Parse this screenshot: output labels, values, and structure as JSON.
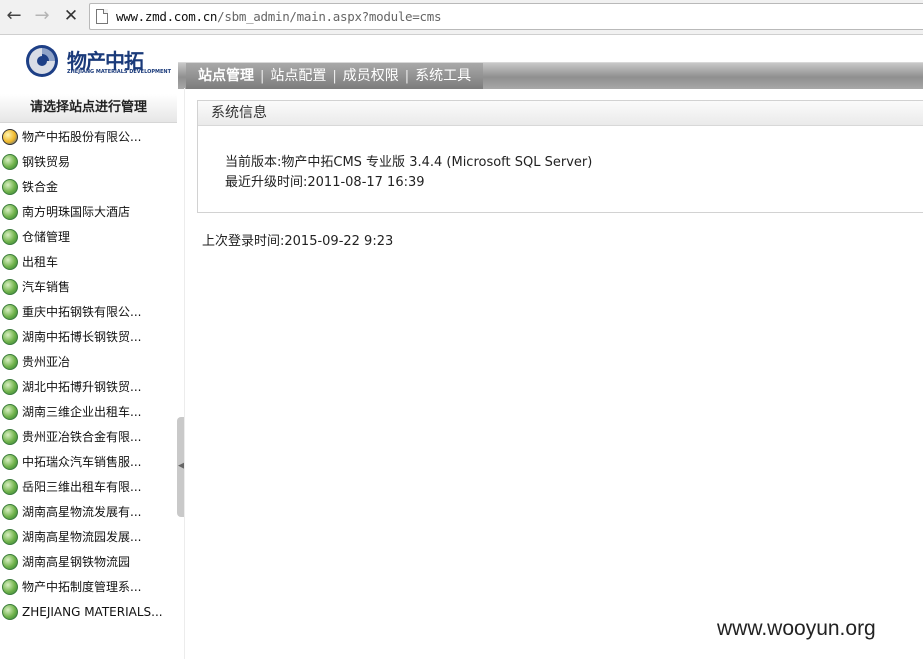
{
  "browser": {
    "url_host": "www.zmd.com.cn",
    "url_path": "/sbm_admin/main.aspx?module=cms"
  },
  "logo": {
    "cn": "物产中拓",
    "en": "ZHEJIANG MATERIALS DEVELOPMENT"
  },
  "top_menu": [
    {
      "label": "站点管理"
    },
    {
      "label": "站点配置"
    },
    {
      "label": "成员权限"
    },
    {
      "label": "系统工具"
    }
  ],
  "sidebar": {
    "header": "请选择站点进行管理",
    "items": [
      {
        "label": "物产中拓股份有限公..."
      },
      {
        "label": "钢铁贸易"
      },
      {
        "label": "铁合金"
      },
      {
        "label": "南方明珠国际大酒店"
      },
      {
        "label": "仓储管理"
      },
      {
        "label": "出租车"
      },
      {
        "label": "汽车销售"
      },
      {
        "label": "重庆中拓钢铁有限公..."
      },
      {
        "label": "湖南中拓博长钢铁贸..."
      },
      {
        "label": "贵州亚冶"
      },
      {
        "label": "湖北中拓博升钢铁贸..."
      },
      {
        "label": "湖南三维企业出租车..."
      },
      {
        "label": "贵州亚冶铁合金有限..."
      },
      {
        "label": "中拓瑞众汽车销售服..."
      },
      {
        "label": "岳阳三维出租车有限..."
      },
      {
        "label": "湖南高星物流发展有..."
      },
      {
        "label": "湖南高星物流园发展..."
      },
      {
        "label": "湖南高星钢铁物流园"
      },
      {
        "label": "物产中拓制度管理系..."
      },
      {
        "label": "ZHEJIANG MATERIALS..."
      }
    ]
  },
  "system_info": {
    "title": "系统信息",
    "version_line": "当前版本:物产中拓CMS 专业版 3.4.4 (Microsoft SQL Server)",
    "upgrade_line": "最近升级时间:2011-08-17 16:39"
  },
  "last_login": "上次登录时间:2015-09-22 9:23",
  "watermark": "www.wooyun.org"
}
